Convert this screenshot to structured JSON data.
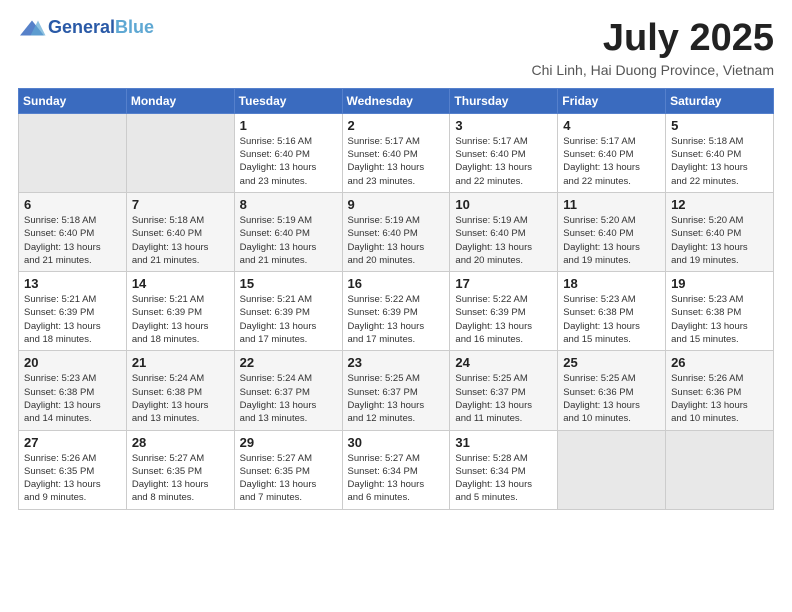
{
  "logo": {
    "line1": "General",
    "line2": "Blue"
  },
  "title": "July 2025",
  "location": "Chi Linh, Hai Duong Province, Vietnam",
  "days_header": [
    "Sunday",
    "Monday",
    "Tuesday",
    "Wednesday",
    "Thursday",
    "Friday",
    "Saturday"
  ],
  "weeks": [
    [
      {
        "num": "",
        "info": ""
      },
      {
        "num": "",
        "info": ""
      },
      {
        "num": "1",
        "info": "Sunrise: 5:16 AM\nSunset: 6:40 PM\nDaylight: 13 hours\nand 23 minutes."
      },
      {
        "num": "2",
        "info": "Sunrise: 5:17 AM\nSunset: 6:40 PM\nDaylight: 13 hours\nand 23 minutes."
      },
      {
        "num": "3",
        "info": "Sunrise: 5:17 AM\nSunset: 6:40 PM\nDaylight: 13 hours\nand 22 minutes."
      },
      {
        "num": "4",
        "info": "Sunrise: 5:17 AM\nSunset: 6:40 PM\nDaylight: 13 hours\nand 22 minutes."
      },
      {
        "num": "5",
        "info": "Sunrise: 5:18 AM\nSunset: 6:40 PM\nDaylight: 13 hours\nand 22 minutes."
      }
    ],
    [
      {
        "num": "6",
        "info": "Sunrise: 5:18 AM\nSunset: 6:40 PM\nDaylight: 13 hours\nand 21 minutes."
      },
      {
        "num": "7",
        "info": "Sunrise: 5:18 AM\nSunset: 6:40 PM\nDaylight: 13 hours\nand 21 minutes."
      },
      {
        "num": "8",
        "info": "Sunrise: 5:19 AM\nSunset: 6:40 PM\nDaylight: 13 hours\nand 21 minutes."
      },
      {
        "num": "9",
        "info": "Sunrise: 5:19 AM\nSunset: 6:40 PM\nDaylight: 13 hours\nand 20 minutes."
      },
      {
        "num": "10",
        "info": "Sunrise: 5:19 AM\nSunset: 6:40 PM\nDaylight: 13 hours\nand 20 minutes."
      },
      {
        "num": "11",
        "info": "Sunrise: 5:20 AM\nSunset: 6:40 PM\nDaylight: 13 hours\nand 19 minutes."
      },
      {
        "num": "12",
        "info": "Sunrise: 5:20 AM\nSunset: 6:40 PM\nDaylight: 13 hours\nand 19 minutes."
      }
    ],
    [
      {
        "num": "13",
        "info": "Sunrise: 5:21 AM\nSunset: 6:39 PM\nDaylight: 13 hours\nand 18 minutes."
      },
      {
        "num": "14",
        "info": "Sunrise: 5:21 AM\nSunset: 6:39 PM\nDaylight: 13 hours\nand 18 minutes."
      },
      {
        "num": "15",
        "info": "Sunrise: 5:21 AM\nSunset: 6:39 PM\nDaylight: 13 hours\nand 17 minutes."
      },
      {
        "num": "16",
        "info": "Sunrise: 5:22 AM\nSunset: 6:39 PM\nDaylight: 13 hours\nand 17 minutes."
      },
      {
        "num": "17",
        "info": "Sunrise: 5:22 AM\nSunset: 6:39 PM\nDaylight: 13 hours\nand 16 minutes."
      },
      {
        "num": "18",
        "info": "Sunrise: 5:23 AM\nSunset: 6:38 PM\nDaylight: 13 hours\nand 15 minutes."
      },
      {
        "num": "19",
        "info": "Sunrise: 5:23 AM\nSunset: 6:38 PM\nDaylight: 13 hours\nand 15 minutes."
      }
    ],
    [
      {
        "num": "20",
        "info": "Sunrise: 5:23 AM\nSunset: 6:38 PM\nDaylight: 13 hours\nand 14 minutes."
      },
      {
        "num": "21",
        "info": "Sunrise: 5:24 AM\nSunset: 6:38 PM\nDaylight: 13 hours\nand 13 minutes."
      },
      {
        "num": "22",
        "info": "Sunrise: 5:24 AM\nSunset: 6:37 PM\nDaylight: 13 hours\nand 13 minutes."
      },
      {
        "num": "23",
        "info": "Sunrise: 5:25 AM\nSunset: 6:37 PM\nDaylight: 13 hours\nand 12 minutes."
      },
      {
        "num": "24",
        "info": "Sunrise: 5:25 AM\nSunset: 6:37 PM\nDaylight: 13 hours\nand 11 minutes."
      },
      {
        "num": "25",
        "info": "Sunrise: 5:25 AM\nSunset: 6:36 PM\nDaylight: 13 hours\nand 10 minutes."
      },
      {
        "num": "26",
        "info": "Sunrise: 5:26 AM\nSunset: 6:36 PM\nDaylight: 13 hours\nand 10 minutes."
      }
    ],
    [
      {
        "num": "27",
        "info": "Sunrise: 5:26 AM\nSunset: 6:35 PM\nDaylight: 13 hours\nand 9 minutes."
      },
      {
        "num": "28",
        "info": "Sunrise: 5:27 AM\nSunset: 6:35 PM\nDaylight: 13 hours\nand 8 minutes."
      },
      {
        "num": "29",
        "info": "Sunrise: 5:27 AM\nSunset: 6:35 PM\nDaylight: 13 hours\nand 7 minutes."
      },
      {
        "num": "30",
        "info": "Sunrise: 5:27 AM\nSunset: 6:34 PM\nDaylight: 13 hours\nand 6 minutes."
      },
      {
        "num": "31",
        "info": "Sunrise: 5:28 AM\nSunset: 6:34 PM\nDaylight: 13 hours\nand 5 minutes."
      },
      {
        "num": "",
        "info": ""
      },
      {
        "num": "",
        "info": ""
      }
    ]
  ]
}
